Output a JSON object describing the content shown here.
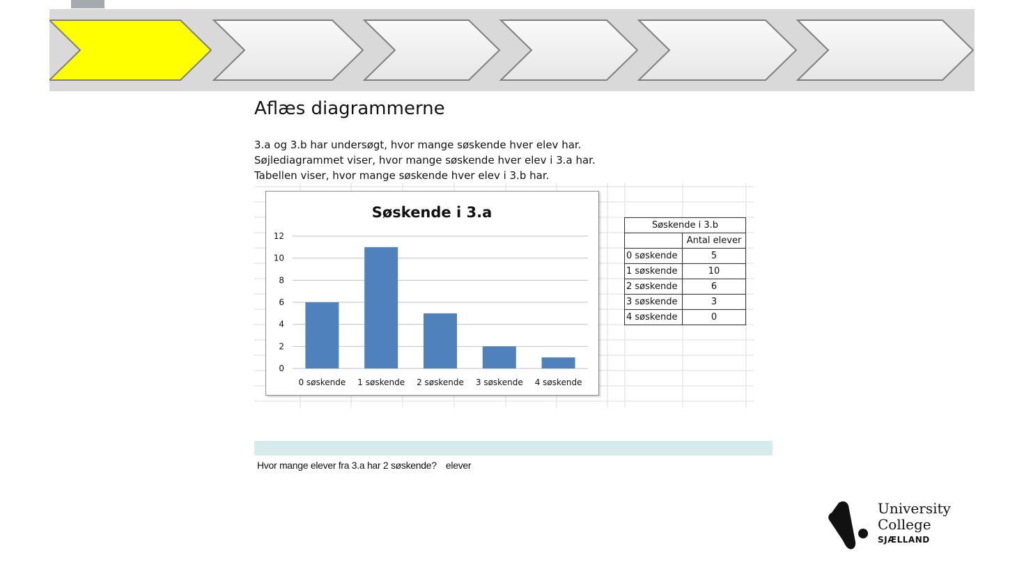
{
  "colors": {
    "active_step": "#ffff00",
    "inactive_step": "#f2f2f2",
    "strip": "#d9d9d9",
    "bar": "#4f81bd",
    "answer_bar": "#d6ecec"
  },
  "progress": {
    "steps": 6,
    "active_step": 1
  },
  "page": {
    "title": "Aflæs diagrammerne",
    "intro_lines": [
      "3.a og 3.b har undersøgt, hvor mange søskende hver elev har.",
      "Søjlediagrammet viser, hvor mange søskende hver elev i 3.a har.",
      "Tabellen viser, hvor mange søskende hver elev i 3.b har."
    ]
  },
  "chart_data": {
    "type": "bar",
    "title": "Søskende i 3.a",
    "categories": [
      "0 søskende",
      "1 søskende",
      "2 søskende",
      "3 søskende",
      "4 søskende"
    ],
    "values": [
      6,
      11,
      5,
      2,
      1
    ],
    "ylim": [
      0,
      12
    ],
    "yticks": [
      "0",
      "2",
      "4",
      "6",
      "8",
      "10",
      "12"
    ],
    "grid": true,
    "legend": "none"
  },
  "table": {
    "title": "Søskende i 3.b",
    "header": [
      "",
      "Antal elever"
    ],
    "rows": [
      [
        "0 søskende",
        "5"
      ],
      [
        "1 søskende",
        "10"
      ],
      [
        "2 søskende",
        "6"
      ],
      [
        "3 søskende",
        "3"
      ],
      [
        "4 søskende",
        "0"
      ]
    ]
  },
  "question": {
    "text": "Hvor mange elever fra 3.a har 2 søskende?",
    "answer_value": "",
    "unit": "elever"
  },
  "logo": {
    "line1": "University",
    "line2": "College",
    "line3": "SJÆLLAND"
  }
}
